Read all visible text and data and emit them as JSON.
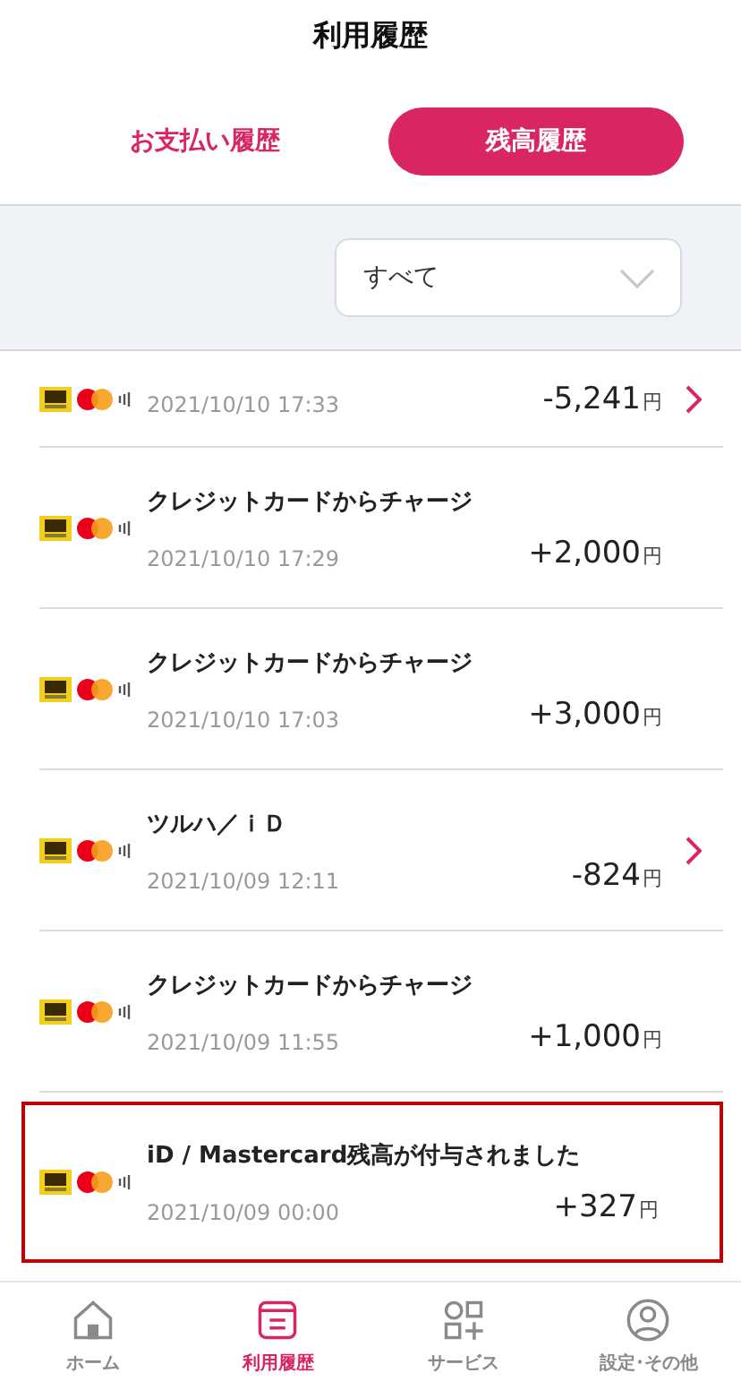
{
  "header": {
    "title": "利用履歴"
  },
  "tabs": [
    {
      "label": "お支払い履歴",
      "selected": false
    },
    {
      "label": "残高履歴",
      "selected": true
    }
  ],
  "filter": {
    "value": "すべて"
  },
  "transactions": [
    {
      "date": "2021/10/10 17:33",
      "amount": "-5,241",
      "unit": "円",
      "has_detail": true,
      "highlighted": false
    },
    {
      "title": "クレジットカードからチャージ",
      "date": "2021/10/10 17:29",
      "amount": "+2,000",
      "unit": "円",
      "has_detail": false,
      "highlighted": false
    },
    {
      "title": "クレジットカードからチャージ",
      "date": "2021/10/10 17:03",
      "amount": "+3,000",
      "unit": "円",
      "has_detail": false,
      "highlighted": false
    },
    {
      "title": "ツルハ／ｉＤ",
      "date": "2021/10/09 12:11",
      "amount": "-824",
      "unit": "円",
      "has_detail": true,
      "highlighted": false
    },
    {
      "title": "クレジットカードからチャージ",
      "date": "2021/10/09 11:55",
      "amount": "+1,000",
      "unit": "円",
      "has_detail": false,
      "highlighted": false
    },
    {
      "title": "iD / Mastercard残高が付与されました",
      "date": "2021/10/09 00:00",
      "amount": "+327",
      "unit": "円",
      "has_detail": false,
      "highlighted": true
    }
  ],
  "nav": [
    {
      "kind": "home",
      "label": "ホーム",
      "selected": false
    },
    {
      "kind": "history",
      "label": "利用履歴",
      "selected": true
    },
    {
      "kind": "services",
      "label": "サービス",
      "selected": false
    },
    {
      "kind": "settings",
      "label": "設定･その他",
      "selected": false
    }
  ]
}
